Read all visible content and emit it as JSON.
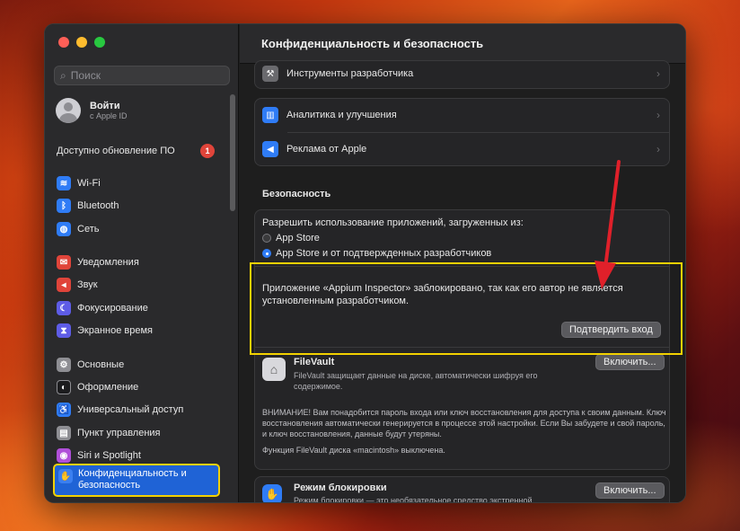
{
  "sidebar": {
    "search_placeholder": "Поиск",
    "account": {
      "name": "Войти",
      "sub": "с Apple ID"
    },
    "update": {
      "label": "Доступно обновление ПО",
      "badge": "1"
    },
    "items": [
      {
        "label": "Wi-Fi",
        "icon": "wifi-icon",
        "color": "#2f7cf6",
        "glyph": "≋"
      },
      {
        "label": "Bluetooth",
        "icon": "bluetooth-icon",
        "color": "#2f7cf6",
        "glyph": "ᛒ"
      },
      {
        "label": "Сеть",
        "icon": "globe-icon",
        "color": "#2f7cf6",
        "glyph": "◍"
      },
      {
        "label": "Уведомления",
        "icon": "bell-icon",
        "color": "#e0443a",
        "glyph": "✉"
      },
      {
        "label": "Звук",
        "icon": "speaker-icon",
        "color": "#e0443a",
        "glyph": "◂"
      },
      {
        "label": "Фокусирование",
        "icon": "moon-icon",
        "color": "#5e5ce6",
        "glyph": "☾"
      },
      {
        "label": "Экранное время",
        "icon": "hourglass-icon",
        "color": "#5e5ce6",
        "glyph": "⧗"
      },
      {
        "label": "Основные",
        "icon": "gear-icon",
        "color": "#8e8e93",
        "glyph": "⚙"
      },
      {
        "label": "Оформление",
        "icon": "appearance-icon",
        "color": "#1c1c1e",
        "glyph": "◐"
      },
      {
        "label": "Универсальный доступ",
        "icon": "accessibility-icon",
        "color": "#2f7cf6",
        "glyph": "♿"
      },
      {
        "label": "Пункт управления",
        "icon": "control-center-icon",
        "color": "#8e8e93",
        "glyph": "▤"
      },
      {
        "label": "Siri и Spotlight",
        "icon": "siri-icon",
        "color": "#b04fd9",
        "glyph": "◉"
      }
    ],
    "selected": {
      "label": "Конфиденциальность и безопасность",
      "icon": "hand-icon"
    }
  },
  "main": {
    "title": "Конфиденциальность и безопасность",
    "rows": [
      {
        "label": "Инструменты разработчика",
        "icon": "developer-tools-icon",
        "color": "#6a6a6e",
        "glyph": "⚒"
      },
      {
        "label": "Аналитика и улучшения",
        "icon": "analytics-icon",
        "color": "#2f7cf6",
        "glyph": "▥"
      },
      {
        "label": "Реклама от Apple",
        "icon": "megaphone-icon",
        "color": "#2f7cf6",
        "glyph": "◀"
      }
    ],
    "security_heading": "Безопасность",
    "allow_label": "Разрешить использование приложений, загруженных из:",
    "options": [
      "App Store",
      "App Store и от подтвержденных разработчиков"
    ],
    "blocked_message": "Приложение «Appium Inspector» заблокировано, так как его автор не является установленным разработчиком.",
    "confirm_button": "Подтвердить вход",
    "filevault": {
      "title": "FileVault",
      "desc": "FileVault защищает данные на диске, автоматически шифруя его содержимое.",
      "button": "Включить...",
      "warning": "ВНИМАНИЕ! Вам понадобится пароль входа или ключ восстановления для доступа к своим данным. Ключ восстановления автоматически генерируется в процессе этой настройки. Если Вы забудете и свой пароль, и ключ восстановления, данные будут утеряны.",
      "status": "Функция FileVault диска «macintosh» выключена."
    },
    "lockdown": {
      "title": "Режим блокировки",
      "desc": "Режим блокировки — это необязательное средство экстренной",
      "button": "Включить..."
    }
  },
  "colors": {
    "highlight": "#f2d100",
    "arrow": "#e0202a",
    "accent": "#1f63d6"
  }
}
